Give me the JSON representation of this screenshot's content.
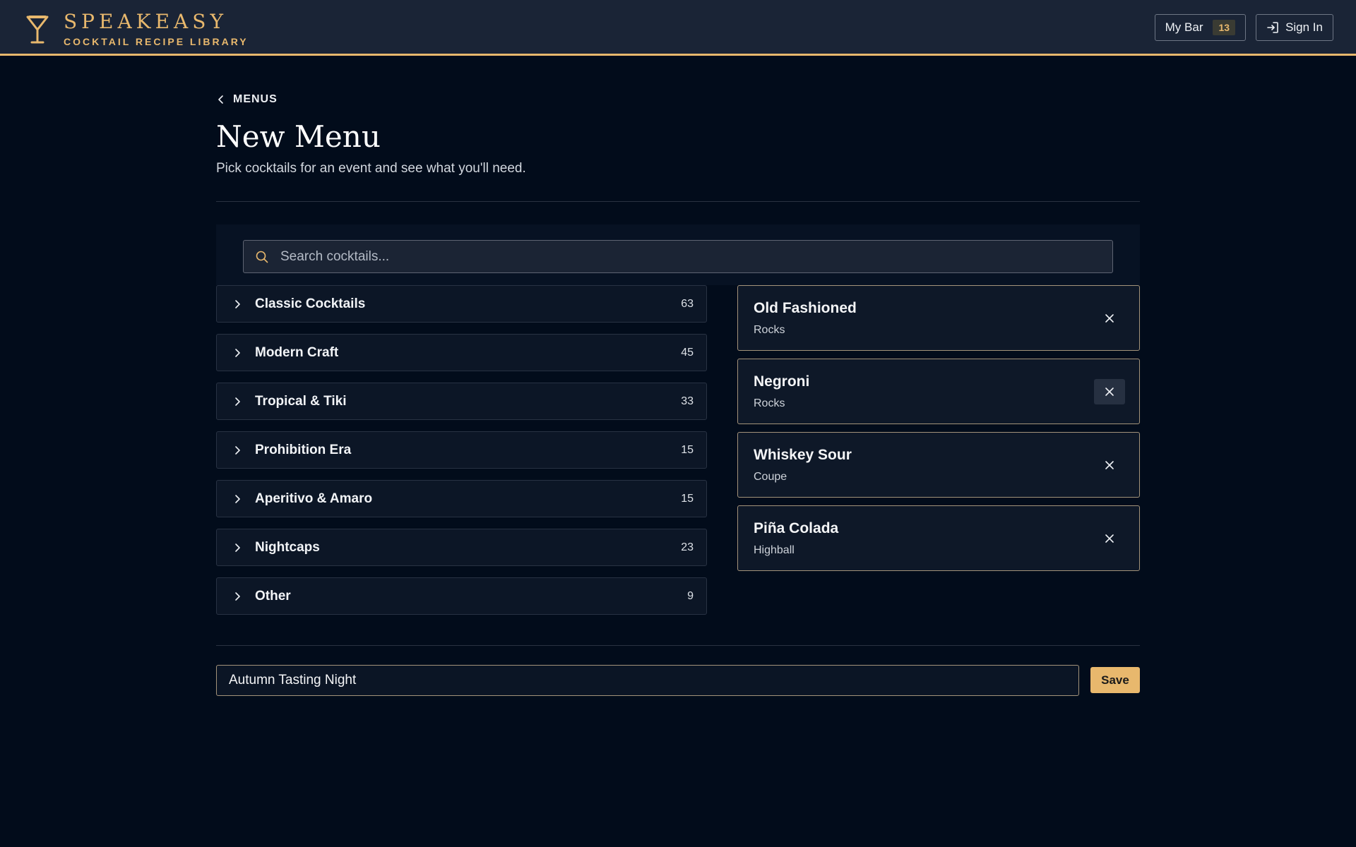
{
  "brand": {
    "name": "SPEAKEASY",
    "tagline": "COCKTAIL RECIPE LIBRARY",
    "icon": "cocktail-glass-icon",
    "accent_color": "#e8b86d"
  },
  "header": {
    "my_bar_label": "My Bar",
    "my_bar_count": "13",
    "sign_in_label": "Sign In"
  },
  "breadcrumb": {
    "back_label": "MENUS"
  },
  "page": {
    "title": "New Menu",
    "subtitle": "Pick cocktails for an event and see what you'll need."
  },
  "search": {
    "placeholder": "Search cocktails...",
    "value": ""
  },
  "categories": [
    {
      "label": "Classic Cocktails",
      "count": "63"
    },
    {
      "label": "Modern Craft",
      "count": "45"
    },
    {
      "label": "Tropical & Tiki",
      "count": "33"
    },
    {
      "label": "Prohibition Era",
      "count": "15"
    },
    {
      "label": "Aperitivo & Amaro",
      "count": "15"
    },
    {
      "label": "Nightcaps",
      "count": "23"
    },
    {
      "label": "Other",
      "count": "9"
    }
  ],
  "selected_cocktails": [
    {
      "name": "Old Fashioned",
      "glass": "Rocks"
    },
    {
      "name": "Negroni",
      "glass": "Rocks"
    },
    {
      "name": "Whiskey Sour",
      "glass": "Coupe"
    },
    {
      "name": "Piña Colada",
      "glass": "Highball"
    }
  ],
  "menu_form": {
    "name_value": "Autumn Tasting Night",
    "save_label": "Save"
  }
}
